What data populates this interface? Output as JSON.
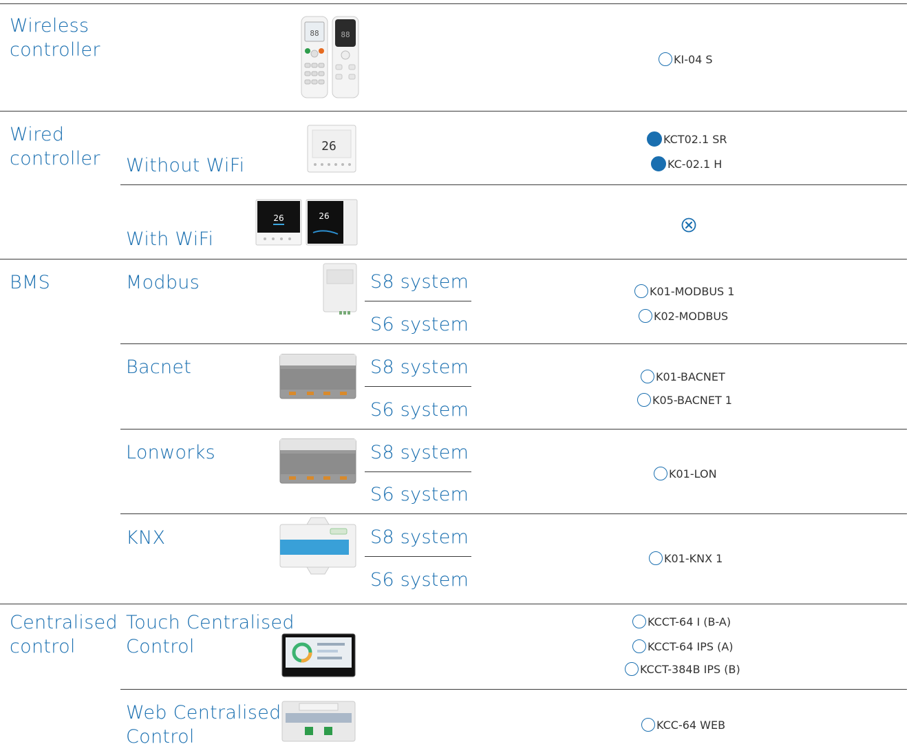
{
  "colors": {
    "accent": "#1a6fb0",
    "rule": "#3a3a3a"
  },
  "rows": {
    "wireless": {
      "category": [
        "Wireless",
        "controller"
      ],
      "codes": [
        "KI-04 S"
      ]
    },
    "wired": {
      "category": [
        "Wired",
        "controller"
      ],
      "without": {
        "label": "Without WiFi",
        "codes": [
          "KCT02.1 SR",
          "KC-02.1 H"
        ]
      },
      "with": {
        "label": "With WiFi",
        "icon": "cross-circle-icon"
      }
    },
    "bms": {
      "category": "BMS",
      "modbus": {
        "label": "Modbus",
        "s8": "S8 system",
        "s6": "S6 system",
        "codes": [
          "K01-MODBUS 1",
          "K02-MODBUS"
        ]
      },
      "bacnet": {
        "label": "Bacnet",
        "s8": "S8 system",
        "s6": "S6 system",
        "codes": [
          "K01-BACNET",
          "K05-BACNET 1"
        ]
      },
      "lonworks": {
        "label": "Lonworks",
        "s8": "S8 system",
        "s6": "S6 system",
        "codes": [
          "K01-LON"
        ]
      },
      "knx": {
        "label": "KNX",
        "s8": "S8 system",
        "s6": "S6 system",
        "codes": [
          "K01-KNX 1"
        ]
      }
    },
    "central": {
      "category": [
        "Centralised",
        "control"
      ],
      "touch": {
        "label": [
          "Touch Centralised",
          "Control"
        ],
        "codes": [
          "KCCT-64 I (B-A)",
          "KCCT-64 IPS (A)",
          "KCCT-384B IPS (B)"
        ]
      },
      "web": {
        "label": [
          "Web Centralised",
          "Control"
        ],
        "codes": [
          "KCC-64 WEB"
        ]
      }
    }
  }
}
